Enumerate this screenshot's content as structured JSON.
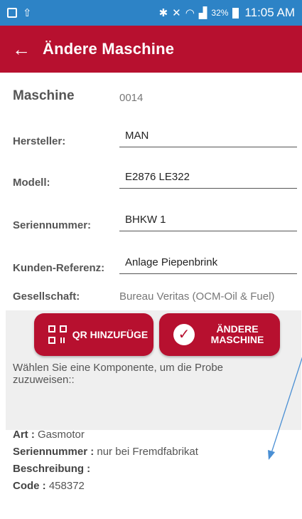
{
  "status_bar": {
    "battery_percent": "32%",
    "time": "11:05 AM"
  },
  "app_bar": {
    "title": "Ändere Maschine"
  },
  "machine": {
    "label": "Maschine",
    "number": "0014"
  },
  "fields": {
    "manufacturer": {
      "label": "Hersteller:",
      "value": "MAN"
    },
    "model": {
      "label": "Modell:",
      "value": "E2876 LE322"
    },
    "serial": {
      "label": "Seriennummer:",
      "value": "BHKW 1"
    },
    "customer_ref": {
      "label": "Kunden-Referenz:",
      "value": "Anlage Piepenbrink"
    },
    "company": {
      "label": "Gesellschaft:",
      "value": "Bureau Veritas (OCM-Oil & Fuel)"
    }
  },
  "buttons": {
    "add_qr": "QR HINZUFÜGE",
    "change_machine": "ÄNDERE MASCHINE"
  },
  "hint": "Wählen Sie eine Komponente, um die Probe zuzuweisen::",
  "component": {
    "type_label": "Art :",
    "type_value": "Gasmotor",
    "serial_label": "Seriennummer :",
    "serial_value": "nur bei Fremdfabrikat",
    "description_label": "Beschreibung :",
    "code_label": "Code :",
    "code_value": "458372"
  },
  "colors": {
    "status_bar": "#2d83c6",
    "app_bar": "#b7102f",
    "annotation_arrow": "#4a8fd4"
  }
}
